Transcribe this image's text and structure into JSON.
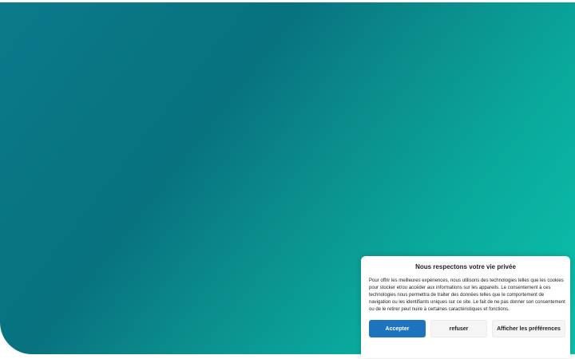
{
  "colors": {
    "hero_start": "#0b7a8a",
    "hero_end": "#0cc2ad",
    "accept_bg": "#1e73be",
    "button_bg": "#f5f5f5"
  },
  "consent": {
    "title": "Nous respectons votre vie privée",
    "body": "Pour offrir les meilleures expériences, nous utilisons des technologies telles que les cookies pour stocker et/ou accéder aux informations sur les appareils. Le consentement à ces technologies nous permettra de traiter des données telles que le comportement de navigation ou les identifiants uniques sur ce site. Le fait de ne pas donner son consentement ou de le retirer peut nuire à certaines caractéristiques et fonctions.",
    "buttons": {
      "accept": "Accepter",
      "refuse": "refuser",
      "preferences": "Afficher les préférences"
    }
  }
}
